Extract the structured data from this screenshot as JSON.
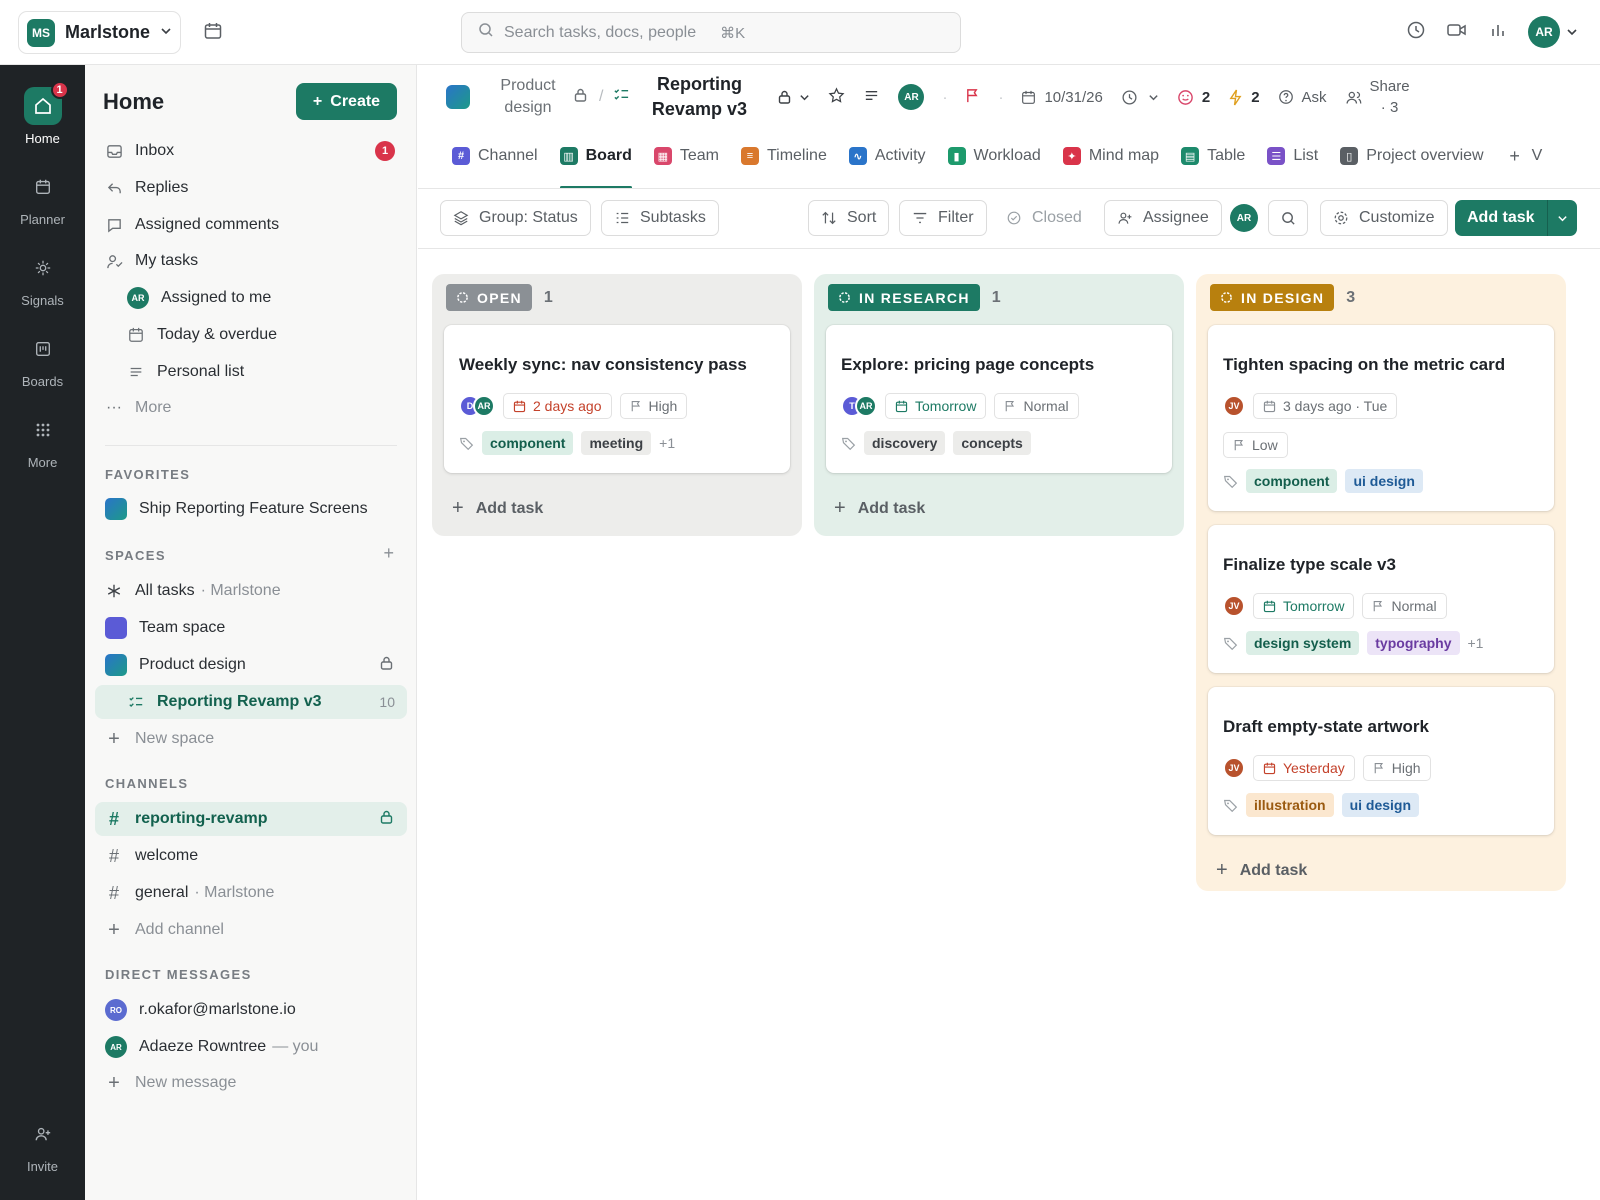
{
  "workspace": {
    "initials": "MS",
    "name": "Marlstone"
  },
  "search": {
    "placeholder": "Search tasks, docs, people",
    "shortcut": "⌘K"
  },
  "user": {
    "initials": "AR"
  },
  "rail": {
    "home": "Home",
    "home_badge": "1",
    "planner": "Planner",
    "signals": "Signals",
    "boards": "Boards",
    "more": "More",
    "invite": "Invite"
  },
  "sidebar": {
    "title": "Home",
    "create_label": "Create",
    "inbox": "Inbox",
    "inbox_badge": "1",
    "replies": "Replies",
    "assigned_comments": "Assigned comments",
    "my_tasks": "My tasks",
    "assigned_to_me": "Assigned to me",
    "today_overdue": "Today & overdue",
    "personal_list": "Personal list",
    "more": "More",
    "favorites_heading": "FAVORITES",
    "favorite_item": "Ship Reporting Feature Screens",
    "spaces_heading": "SPACES",
    "all_tasks": "All tasks",
    "all_tasks_sub": "· Marlstone",
    "team_space": "Team space",
    "product_design": "Product design",
    "reporting_revamp": "Reporting Revamp v3",
    "reporting_revamp_count": "10",
    "new_space": "New space",
    "channels_heading": "CHANNELS",
    "channel_reporting": "reporting-revamp",
    "channel_welcome": "welcome",
    "channel_general": "general",
    "channel_general_sub": "· Marlstone",
    "add_channel": "Add channel",
    "dm_heading": "DIRECT MESSAGES",
    "dm_ro_initials": "RO",
    "dm_ro": "r.okafor@marlstone.io",
    "dm_ar": "Adaeze Rowntree",
    "dm_ar_sub": "— you",
    "new_message": "New message"
  },
  "header": {
    "project": "Product design",
    "title": "Reporting Revamp v3",
    "date": "10/31/26",
    "emoji_count": "2",
    "bolt_count": "2",
    "ask": "Ask",
    "share": "Share · 3"
  },
  "tabs": [
    {
      "label": "Channel",
      "color": "#5b5bd6",
      "glyph": "#"
    },
    {
      "label": "Board",
      "color": "#1d7a64",
      "glyph": "▥"
    },
    {
      "label": "Team",
      "color": "#d9476b",
      "glyph": "▦"
    },
    {
      "label": "Timeline",
      "color": "#d9782d",
      "glyph": "≡"
    },
    {
      "label": "Activity",
      "color": "#2a74c9",
      "glyph": "∿"
    },
    {
      "label": "Workload",
      "color": "#1d9a6c",
      "glyph": "▮"
    },
    {
      "label": "Mind map",
      "color": "#d9344a",
      "glyph": "✦"
    },
    {
      "label": "Table",
      "color": "#1d8a6c",
      "glyph": "▤"
    },
    {
      "label": "List",
      "color": "#7a52c7",
      "glyph": "☰"
    },
    {
      "label": "Project overview",
      "color": "#5a5f64",
      "glyph": "▯"
    },
    {
      "label": "V",
      "color": "",
      "glyph": "+"
    }
  ],
  "toolbar": {
    "group": "Group: Status",
    "subtasks": "Subtasks",
    "sort": "Sort",
    "filter": "Filter",
    "closed": "Closed",
    "assignee": "Assignee",
    "customize": "Customize",
    "add_task": "Add task"
  },
  "columns": [
    {
      "status": "OPEN",
      "count": "1",
      "color": "#8b9095",
      "bg": "#ededeb",
      "add_label": "Add task",
      "cards": [
        {
          "title": "Weekly sync: nav consistency pass",
          "avatars": [
            {
              "i": "D",
              "c": "av-d"
            },
            {
              "i": "AR",
              "c": "av-ar"
            }
          ],
          "date": "2 days ago",
          "date_style": "red",
          "priority": "High",
          "tags": [
            {
              "t": "component",
              "c": "tag-green"
            },
            {
              "t": "meeting",
              "c": "tag-gray"
            }
          ],
          "more": "+1"
        }
      ]
    },
    {
      "status": "IN RESEARCH",
      "count": "1",
      "color": "#1d7a64",
      "bg": "#e3efe9",
      "add_label": "Add task",
      "cards": [
        {
          "title": "Explore: pricing page concepts",
          "avatars": [
            {
              "i": "T",
              "c": "av-d"
            },
            {
              "i": "AR",
              "c": "av-ar"
            }
          ],
          "date": "Tomorrow",
          "date_style": "green",
          "priority": "Normal",
          "tags": [
            {
              "t": "discovery",
              "c": "tag-gray"
            },
            {
              "t": "concepts",
              "c": "tag-gray"
            }
          ],
          "more": ""
        }
      ]
    },
    {
      "status": "IN DESIGN",
      "count": "3",
      "color": "#b8800e",
      "bg": "#fdf1df",
      "add_label": "Add task",
      "cards": [
        {
          "title": "Tighten spacing on the metric card",
          "avatars": [
            {
              "i": "JV",
              "c": "av-jv"
            }
          ],
          "date": "3 days ago · Tue",
          "date_style": "",
          "priority": "Low",
          "tags": [
            {
              "t": "component",
              "c": "tag-green"
            },
            {
              "t": "ui design",
              "c": "tag-blue"
            }
          ],
          "more": ""
        },
        {
          "title": "Finalize type scale v3",
          "avatars": [
            {
              "i": "JV",
              "c": "av-jv"
            }
          ],
          "date": "Tomorrow",
          "date_style": "green",
          "priority": "Normal",
          "tags": [
            {
              "t": "design system",
              "c": "tag-green"
            },
            {
              "t": "typography",
              "c": "tag-purple"
            }
          ],
          "more": "+1"
        },
        {
          "title": "Draft empty-state artwork",
          "avatars": [
            {
              "i": "JV",
              "c": "av-jv"
            }
          ],
          "date": "Yesterday",
          "date_style": "red",
          "priority": "High",
          "tags": [
            {
              "t": "illustration",
              "c": "tag-orange"
            },
            {
              "t": "ui design",
              "c": "tag-blue"
            }
          ],
          "more": ""
        }
      ]
    }
  ]
}
